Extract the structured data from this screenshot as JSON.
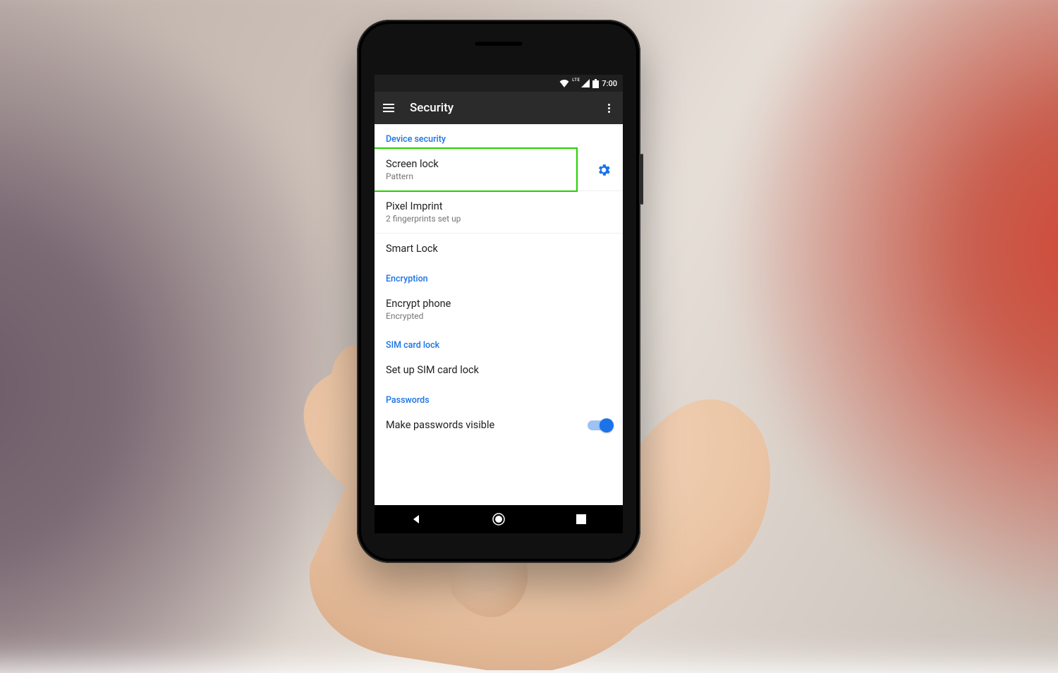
{
  "status": {
    "lte": "LTE",
    "time": "7:00"
  },
  "appbar": {
    "title": "Security"
  },
  "sections": {
    "device_security": {
      "header": "Device security",
      "screen_lock": {
        "title": "Screen lock",
        "subtitle": "Pattern"
      },
      "pixel_imprint": {
        "title": "Pixel Imprint",
        "subtitle": "2 fingerprints set up"
      },
      "smart_lock": {
        "title": "Smart Lock"
      }
    },
    "encryption": {
      "header": "Encryption",
      "encrypt_phone": {
        "title": "Encrypt phone",
        "subtitle": "Encrypted"
      }
    },
    "sim": {
      "header": "SIM card lock",
      "setup": {
        "title": "Set up SIM card lock"
      }
    },
    "passwords": {
      "header": "Passwords",
      "visible": {
        "title": "Make passwords visible",
        "on": true
      }
    }
  }
}
